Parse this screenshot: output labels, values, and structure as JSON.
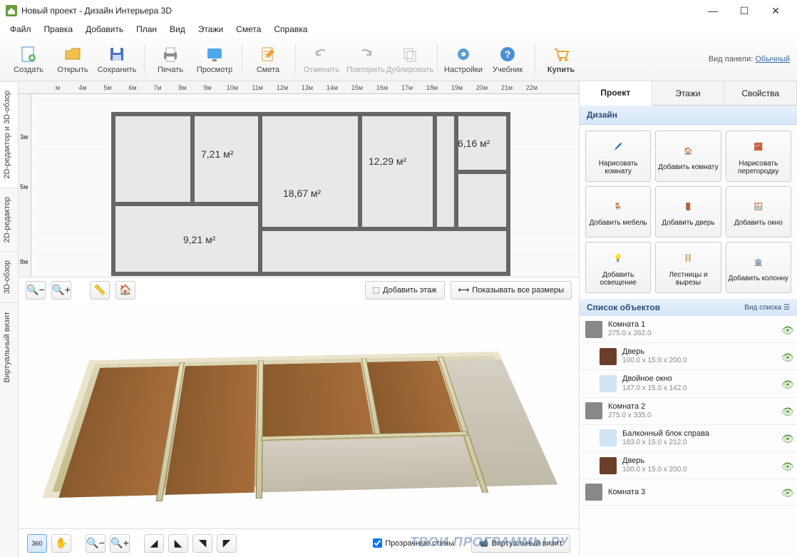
{
  "window": {
    "title": "Новый проект - Дизайн Интерьера 3D"
  },
  "menu": [
    "Файл",
    "Правка",
    "Добавить",
    "План",
    "Вид",
    "Этажи",
    "Смета",
    "Справка"
  ],
  "toolbar": {
    "create": "Создать",
    "open": "Открыть",
    "save": "Сохранить",
    "print": "Печать",
    "preview": "Просмотр",
    "estimate": "Смета",
    "undo": "Отменить",
    "redo": "Повторить",
    "duplicate": "Дублировать",
    "settings": "Настройки",
    "tutorial": "Учебник",
    "buy": "Купить",
    "panel_label": "Вид панели:",
    "panel_mode": "Обычный"
  },
  "vtabs": {
    "t1": "2D-редактор и 3D-обзор",
    "t2": "2D-редактор",
    "t3": "3D-обзор",
    "t4": "Виртуальный визит"
  },
  "ruler_h": [
    "м",
    "4м",
    "5м",
    "6м",
    "7м",
    "8м",
    "9м",
    "10м",
    "11м",
    "12м",
    "13м",
    "14м",
    "15м",
    "16м",
    "17м",
    "18м",
    "19м",
    "20м",
    "21м",
    "22м"
  ],
  "ruler_v": [
    "3м",
    "5м",
    "8м"
  ],
  "rooms": {
    "r1": "7,21 м²",
    "r2": "18,67 м²",
    "r3": "12,29 м²",
    "r4": "6,16 м²",
    "r5": "9,21 м²"
  },
  "plan_bar": {
    "add_floor": "Добавить этаж",
    "show_dims": "Показывать все размеры"
  },
  "bottom": {
    "transparent": "Прозрачные стены",
    "virtual": "Виртуальный визит"
  },
  "side": {
    "tab_project": "Проект",
    "tab_floors": "Этажи",
    "tab_props": "Свойства",
    "design_hdr": "Дизайн",
    "btn_draw_room": "Нарисовать комнату",
    "btn_add_room": "Добавить комнату",
    "btn_draw_part": "Нарисовать перегородку",
    "btn_add_furn": "Добавить мебель",
    "btn_add_door": "Добавить дверь",
    "btn_add_win": "Добавить окно",
    "btn_add_light": "Добавить освещение",
    "btn_stairs": "Лестницы и вырезы",
    "btn_column": "Добавить колонну",
    "objlist_hdr": "Список объектов",
    "objlist_mode": "Вид списка"
  },
  "objects": [
    {
      "name": "Комната 1",
      "dims": "275.0 x 262.0",
      "type": "room"
    },
    {
      "name": "Дверь",
      "dims": "100.0 x 15.0 x 200.0",
      "type": "door",
      "child": true
    },
    {
      "name": "Двойное окно",
      "dims": "147.0 x 15.0 x 142.0",
      "type": "window",
      "child": true
    },
    {
      "name": "Комната 2",
      "dims": "275.0 x 335.0",
      "type": "room"
    },
    {
      "name": "Балконный блок справа",
      "dims": "183.0 x 15.0 x 212.0",
      "type": "window",
      "child": true
    },
    {
      "name": "Дверь",
      "dims": "100.0 x 15.0 x 200.0",
      "type": "door",
      "child": true
    },
    {
      "name": "Комната 3",
      "dims": "",
      "type": "room"
    }
  ],
  "watermark": "ТВОИ ПРОГРАММЫ РУ"
}
